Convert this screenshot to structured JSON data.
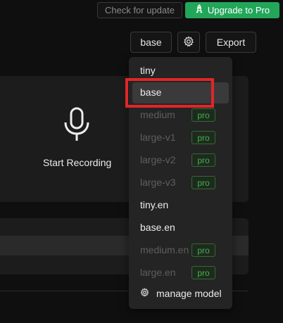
{
  "header": {
    "check_update_label": "Check for update",
    "upgrade_label": "Upgrade to Pro",
    "upgrade_icon": "rocket-icon"
  },
  "toolbar": {
    "model_label": "base",
    "settings_icon": "gear-icon",
    "export_label": "Export"
  },
  "recorder": {
    "icon": "microphone-icon",
    "label": "Start Recording"
  },
  "model_menu": {
    "items": [
      {
        "label": "tiny",
        "pro": false
      },
      {
        "label": "base",
        "pro": false,
        "selected": true
      },
      {
        "label": "medium",
        "pro": true
      },
      {
        "label": "large-v1",
        "pro": true
      },
      {
        "label": "large-v2",
        "pro": true
      },
      {
        "label": "large-v3",
        "pro": true
      },
      {
        "label": "tiny.en",
        "pro": false
      },
      {
        "label": "base.en",
        "pro": false
      },
      {
        "label": "medium.en",
        "pro": true
      },
      {
        "label": "large.en",
        "pro": true
      }
    ],
    "pro_badge": "pro",
    "manage_label": "manage model",
    "manage_icon": "gear-icon"
  },
  "colors": {
    "accent_green": "#22a65a",
    "highlight_red": "#e0262a",
    "pro_green": "#3fb24a"
  }
}
